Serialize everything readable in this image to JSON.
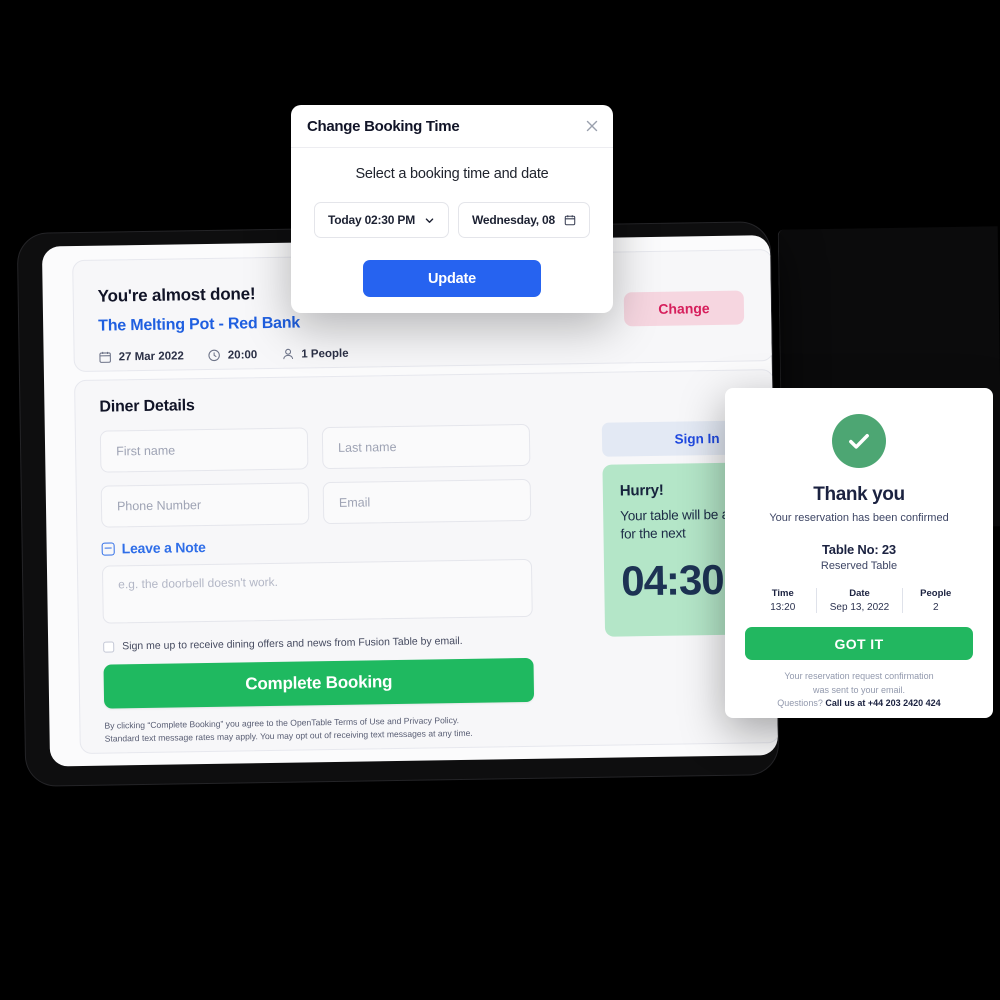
{
  "booking_summary": {
    "title": "You're almost done!",
    "venue": "The Melting Pot - Red Bank",
    "date": "27 Mar 2022",
    "time": "20:00",
    "party": "1 People",
    "change_label": "Change"
  },
  "diner_details": {
    "section_title": "Diner Details",
    "first_name_placeholder": "First name",
    "last_name_placeholder": "Last name",
    "phone_placeholder": "Phone Number",
    "email_placeholder": "Email",
    "note_toggle_label": "Leave a Note",
    "note_placeholder": "e.g. the doorbell doesn't work.",
    "optin_label": "Sign me up to receive dining offers and news from Fusion Table by email.",
    "complete_label": "Complete Booking",
    "legal_line1": "By clicking “Complete Booking” you agree to the OpenTable Terms of Use and Privacy Policy.",
    "legal_line2": "Standard text message rates may apply. You may opt out of receiving text messages at any time."
  },
  "side_panel": {
    "signin_label": "Sign In",
    "hurry_title": "Hurry!",
    "hurry_subtitle": "Your table will be available for the next",
    "timer": "04:30"
  },
  "modal": {
    "title": "Change Booking Time",
    "subtitle": "Select a booking time and date",
    "time_value": "Today 02:30 PM",
    "date_value": "Wednesday, 08",
    "update_label": "Update"
  },
  "confirmation": {
    "title": "Thank you",
    "subtitle": "Your reservation has been confirmed",
    "table_no": "Table No: 23",
    "table_sub": "Reserved Table",
    "details": [
      {
        "label": "Time",
        "value": "13:20"
      },
      {
        "label": "Date",
        "value": "Sep 13, 2022"
      },
      {
        "label": "People",
        "value": "2"
      }
    ],
    "cta_label": "GOT IT",
    "foot_line1": "Your reservation request confirmation",
    "foot_line2": "was sent to your email.",
    "foot_question": "Questions?",
    "foot_phone": "Call us at +44 203 2420 424"
  },
  "colors": {
    "primary_blue": "#2663f0",
    "green": "#1fb960",
    "confirm_green": "#4da673",
    "pink": "#f6d6e0",
    "pink_text": "#d61f5c",
    "mint": "#b4e6c8",
    "navy": "#1d3354"
  }
}
